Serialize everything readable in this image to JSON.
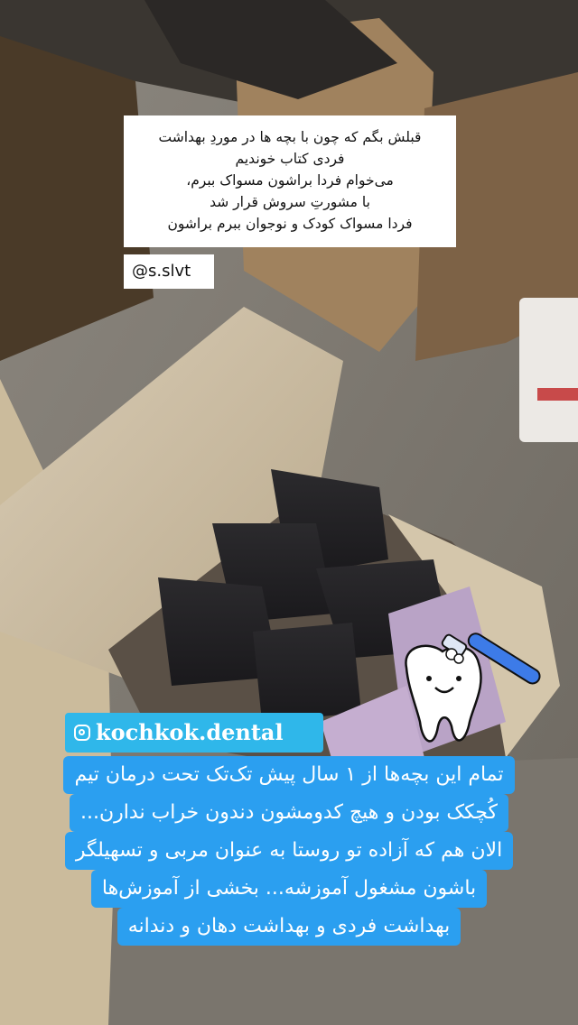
{
  "caption": {
    "lines": [
      "قبلش بگم که چون با بچه ها در موردِ بهداشت",
      "فردی کتاب خوندیم",
      "می‌خوام فردا براشون مسواک ببرم،",
      "با مشورتِ سروش قرار شد",
      "فردا مسواک کودک و نوجوان ببرم براشون"
    ]
  },
  "user_tag": "@s.slvt",
  "brand_tag": "kochkok.dental",
  "blue_caption": {
    "lines": [
      "تمام این بچه‌ها از ۱ سال پیش تک‌تک تحت درمان تیم",
      "کُچکک بودن و هیچ کدومشون دندون خراب ندارن...",
      "الان هم که آزاده تو روستا به عنوان مربی و تسهیلگر",
      "باشون مشغول آموزشه... بخشی از آموزش‌ها",
      "بهداشت فردی و بهداشت دهان و دندانه"
    ]
  },
  "colors": {
    "caption_bg": "#ffffff",
    "brand_bg": "#2fb7ea",
    "blue_caption_bg": "#2b9ff0",
    "cardboard": "#c9b79a"
  }
}
